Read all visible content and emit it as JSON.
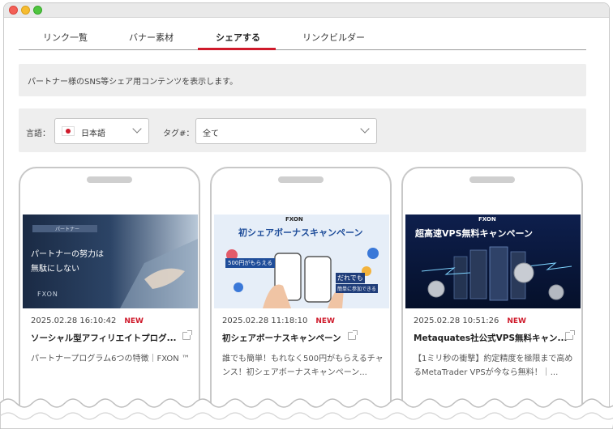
{
  "tabs": [
    {
      "label": "リンク一覧"
    },
    {
      "label": "バナー素材"
    },
    {
      "label": "シェアする"
    },
    {
      "label": "リンクビルダー"
    }
  ],
  "notice": "パートナー様のSNS等シェア用コンテンツを表示します。",
  "filters": {
    "language_label": "言語：",
    "language_value": "日本語",
    "tag_label": "タグ#：",
    "tag_value": "全て"
  },
  "cards": [
    {
      "date": "2025.02.28 16:10:42",
      "badge": "NEW",
      "title": "ソーシャル型アフィリエイトプログ...",
      "description": "パートナープログラム6つの特徴｜FXON ™",
      "banner": {
        "tag": "パートナー",
        "line1": "パートナーの努力は",
        "line2": "無駄にしない",
        "logo": "FXON"
      }
    },
    {
      "date": "2025.02.28 11:18:10",
      "badge": "NEW",
      "title": "初シェアボーナスキャンペーン",
      "description": "誰でも簡単！もれなく500円がもらえるチャンス！初シェアボーナスキャンペーン...",
      "banner": {
        "logo": "FXON",
        "headline": "初シェアボーナスキャンペーン",
        "sub": "500円がもらえる",
        "tagline1": "だれでも",
        "tagline2": "簡単に参加できる"
      }
    },
    {
      "date": "2025.02.28 10:51:26",
      "badge": "NEW",
      "title": "Metaquates社公式VPS無料キャン...",
      "description": "【1ミリ秒の衝撃】約定精度を極限まで高めるMetaTrader VPSが今なら無料！｜...",
      "banner": {
        "logo": "FXON",
        "headline": "超高速VPS無料キャンペーン"
      }
    }
  ],
  "colors": {
    "accent": "#cf1a2b",
    "panel": "#eeeeee"
  }
}
